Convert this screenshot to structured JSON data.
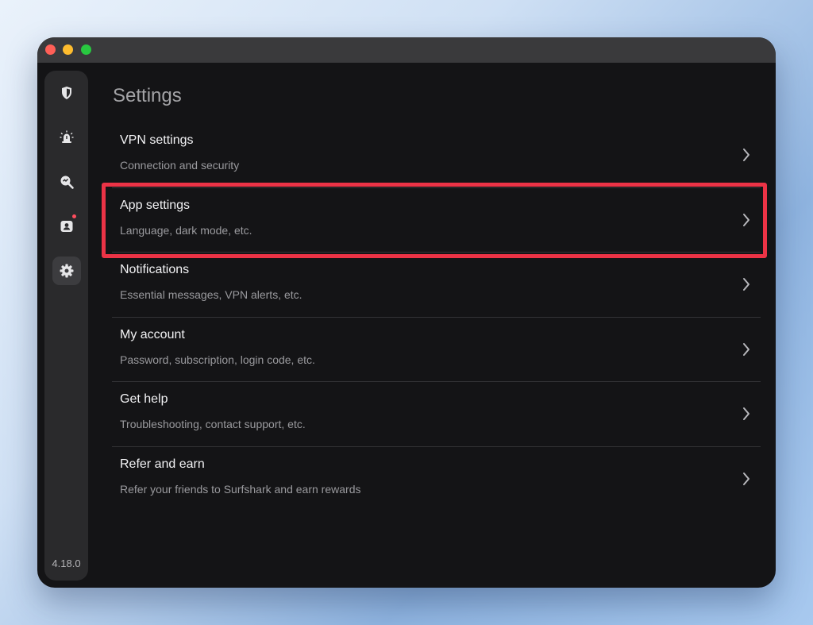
{
  "app": {
    "version": "4.18.0"
  },
  "sidebar": {
    "items": [
      {
        "icon": "shield-icon",
        "active": false
      },
      {
        "icon": "alert-icon",
        "active": false
      },
      {
        "icon": "search-icon",
        "active": false
      },
      {
        "icon": "contact-icon",
        "active": false,
        "badge": true
      },
      {
        "icon": "gear-icon",
        "active": true
      }
    ]
  },
  "main": {
    "title": "Settings",
    "rows": [
      {
        "title": "VPN settings",
        "subtitle": "Connection and security"
      },
      {
        "title": "App settings",
        "subtitle": "Language, dark mode, etc."
      },
      {
        "title": "Notifications",
        "subtitle": "Essential messages, VPN alerts, etc."
      },
      {
        "title": "My account",
        "subtitle": "Password, subscription, login code, etc."
      },
      {
        "title": "Get help",
        "subtitle": "Troubleshooting, contact support, etc."
      },
      {
        "title": "Refer and earn",
        "subtitle": "Refer your friends to Surfshark and earn rewards"
      }
    ]
  },
  "colors": {
    "background": "#141416",
    "highlight": "#ec3346",
    "badge": "#ff4d5e"
  }
}
